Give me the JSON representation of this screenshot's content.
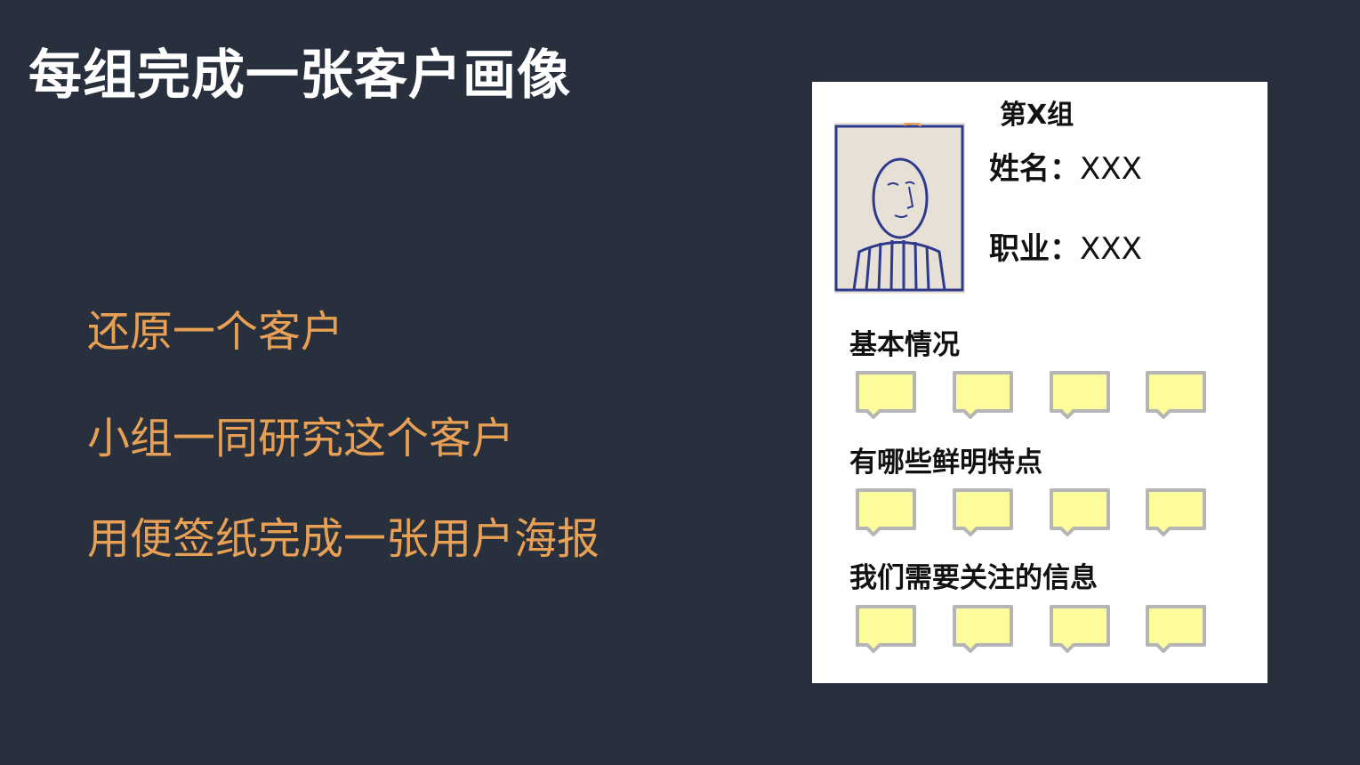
{
  "slide": {
    "title": "每组完成一张客户画像",
    "bullets": [
      "还原一个客户",
      "小组一同研究这个客户",
      "用便签纸完成一张用户海报"
    ]
  },
  "poster": {
    "group_title": "第X组",
    "name_label": "姓名：",
    "name_value": "XXX",
    "job_label": "职业：",
    "job_value": "XXX",
    "sections": [
      {
        "label": "基本情况",
        "notes": 4
      },
      {
        "label": "有哪些鲜明特点",
        "notes": 4
      },
      {
        "label": "我们需要关注的信息",
        "notes": 4
      }
    ]
  },
  "colors": {
    "background": "#28303d",
    "title": "#ffffff",
    "bullet": "#e8a154",
    "note_fill": "#fdfc9c",
    "note_border": "#b5b5b5",
    "drawing_ink": "#2e3a8c"
  },
  "icons": {
    "portrait": "hand-drawn-portrait",
    "note": "sticky-note-icon"
  }
}
